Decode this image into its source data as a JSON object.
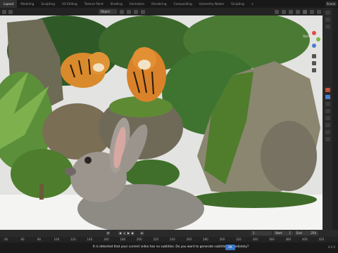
{
  "workspace_tabs": [
    "Layout",
    "Modeling",
    "Sculpting",
    "UV Editing",
    "Texture Paint",
    "Shading",
    "Animation",
    "Rendering",
    "Compositing",
    "Geometry Nodes",
    "Scripting",
    "+"
  ],
  "active_tab_index": 0,
  "scene_label": "Scene",
  "viewport": {
    "mode": "Object",
    "options_label": "Options"
  },
  "timeline": {
    "current_frame": "1",
    "start_label": "Start",
    "start_value": "1",
    "end_label": "End",
    "end_value": "250",
    "ruler": [
      "40",
      "60",
      "80",
      "100",
      "120",
      "140",
      "160",
      "180",
      "200",
      "220",
      "240",
      "260",
      "280",
      "300",
      "320",
      "340",
      "360",
      "380",
      "400",
      "420"
    ]
  },
  "notification": {
    "text": "It is detected that your current video has no subtitles. Do you want to generate subtitles immediately?",
    "ok_label": "OK"
  },
  "status_right": "4.0.0",
  "colors": {
    "accent": "#3a75c4",
    "gizmo_x": "#e04a4a",
    "gizmo_y": "#7ab648",
    "gizmo_z": "#4a7fd1"
  }
}
